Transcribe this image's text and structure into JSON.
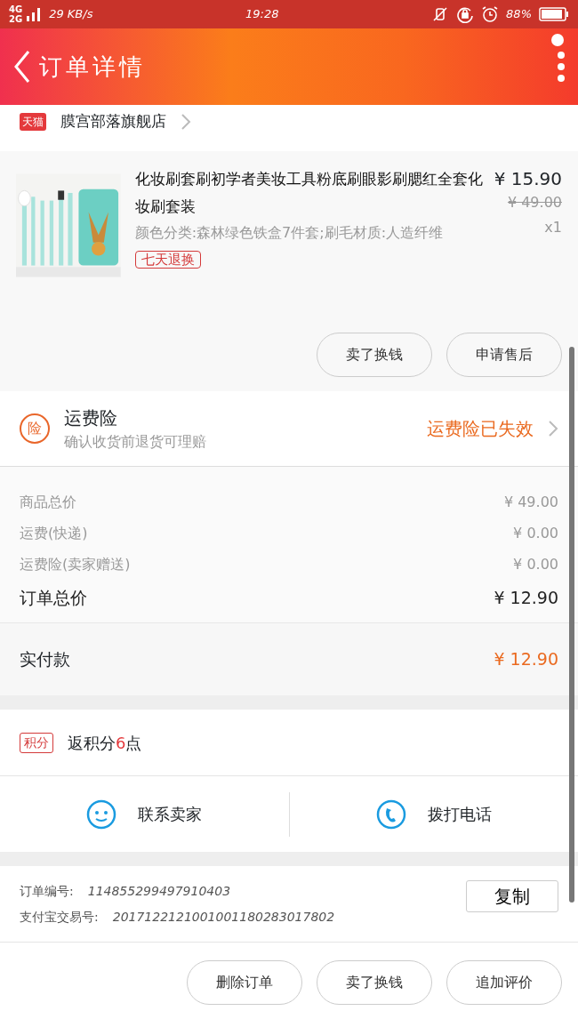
{
  "status_bar": {
    "networks": [
      "4G",
      "2G"
    ],
    "speed": "29 KB/s",
    "time": "19:28",
    "battery": "88%"
  },
  "header": {
    "title": "订单详情"
  },
  "store": {
    "badge": "天猫",
    "name": "膜宫部落旗舰店"
  },
  "product": {
    "title": "化妆刷套刷初学者美妆工具粉底刷眼影刷腮红全套化妆刷套装",
    "price": "¥ 15.90",
    "original_price": "¥ 49.00",
    "variant": "颜色分类:森林绿色铁盒7件套;刷毛材质:人造纤维",
    "quantity": "x1",
    "tag": "七天退换",
    "actions": [
      "卖了换钱",
      "申请售后"
    ]
  },
  "insurance": {
    "icon_label": "险",
    "title": "运费险",
    "subtitle": "确认收货前退货可理赔",
    "status": "运费险已失效"
  },
  "costs": [
    {
      "label": "商品总价",
      "value": "¥ 49.00"
    },
    {
      "label": "运费(快递)",
      "value": "¥ 0.00"
    },
    {
      "label": "运费险(卖家赠送)",
      "value": "¥ 0.00"
    }
  ],
  "order_total": {
    "label": "订单总价",
    "value": "¥ 12.90"
  },
  "paid": {
    "label": "实付款",
    "value": "¥ 12.90"
  },
  "points": {
    "badge": "积分",
    "text": "返积分**6**点"
  },
  "contact": [
    "联系卖家",
    "拨打电话"
  ],
  "order_info": [
    {
      "label": "订单编号:",
      "value": "114855299497910403"
    },
    {
      "label": "支付宝交易号:",
      "value": "2017122121001001180283017802"
    }
  ],
  "copy_button": "复制",
  "bottom_actions": [
    "删除订单",
    "卖了换钱",
    "追加评价"
  ]
}
